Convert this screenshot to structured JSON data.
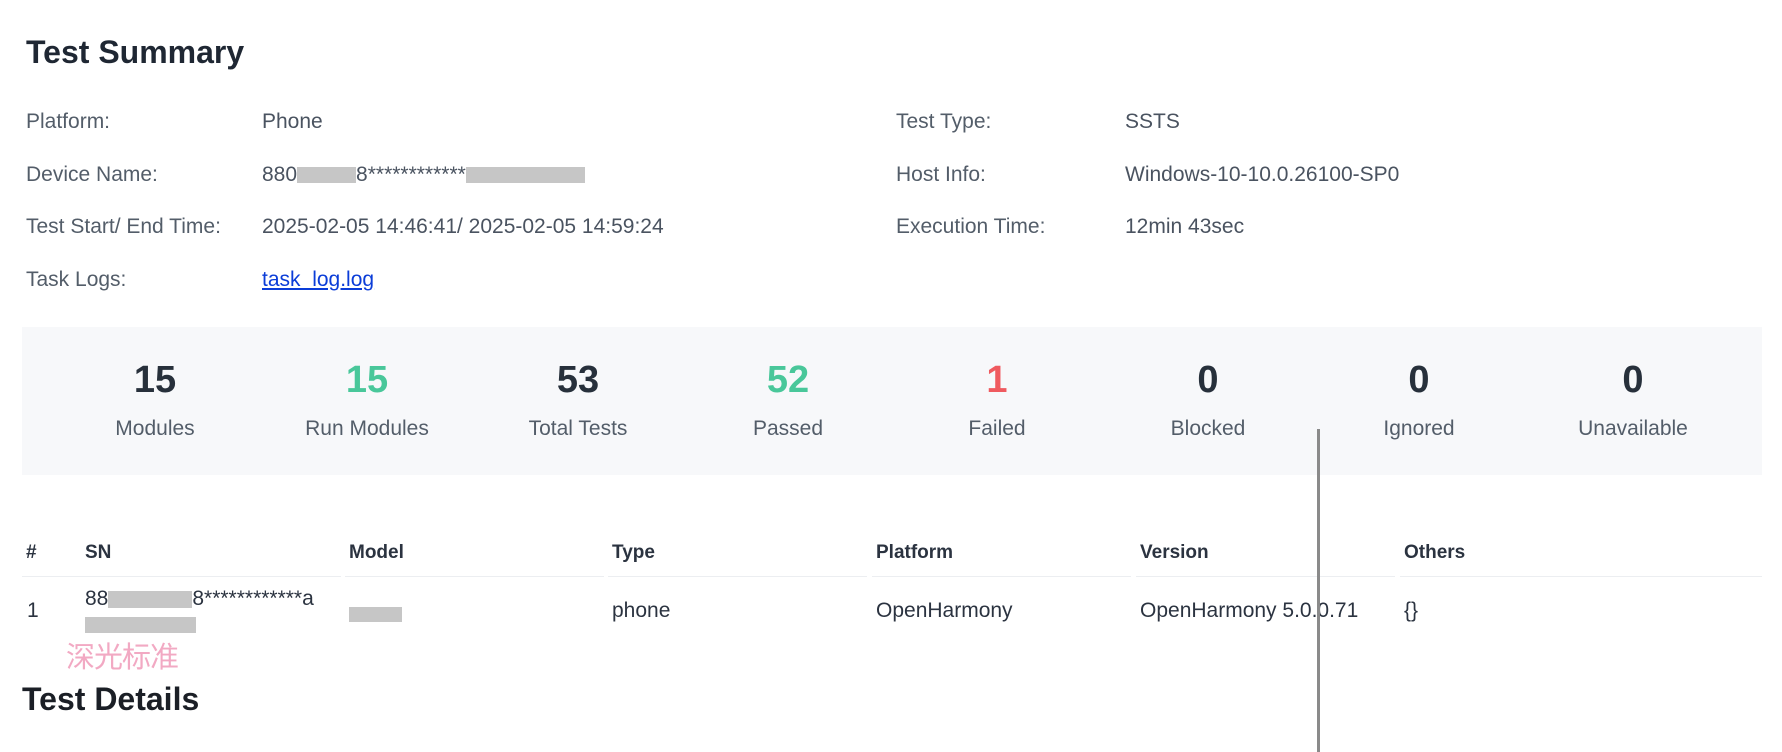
{
  "summary": {
    "title": "Test Summary",
    "platform_label": "Platform:",
    "platform_value": "Phone",
    "device_label": "Device Name:",
    "device_value_prefix": "880",
    "device_value_mid": "8************",
    "time_label": "Test Start/ End Time:",
    "time_value": "2025-02-05 14:46:41/ 2025-02-05 14:59:24",
    "logs_label": "Task Logs:",
    "logs_link": "task_log.log",
    "type_label": "Test Type:",
    "type_value": "SSTS",
    "host_label": "Host Info:",
    "host_value": "Windows-10-10.0.26100-SP0",
    "exec_label": "Execution Time:",
    "exec_value": "12min 43sec"
  },
  "stats": [
    {
      "value": "15",
      "label": "Modules",
      "color": "#27303b"
    },
    {
      "value": "15",
      "label": "Run Modules",
      "color": "#49c79a"
    },
    {
      "value": "53",
      "label": "Total Tests",
      "color": "#27303b"
    },
    {
      "value": "52",
      "label": "Passed",
      "color": "#49c79a"
    },
    {
      "value": "1",
      "label": "Failed",
      "color": "#ef5a5f"
    },
    {
      "value": "0",
      "label": "Blocked",
      "color": "#27303b"
    },
    {
      "value": "0",
      "label": "Ignored",
      "color": "#27303b"
    },
    {
      "value": "0",
      "label": "Unavailable",
      "color": "#27303b"
    }
  ],
  "device_table": {
    "headers": [
      "#",
      "SN",
      "Model",
      "Type",
      "Platform",
      "Version",
      "Others"
    ],
    "rows": [
      {
        "index": "1",
        "sn_prefix": "88",
        "sn_mid": "8************a",
        "type": "phone",
        "platform": "OpenHarmony",
        "version": "OpenHarmony 5.0.0.71",
        "others": "{}"
      }
    ]
  },
  "watermark": "深光标准",
  "details_title": "Test Details"
}
